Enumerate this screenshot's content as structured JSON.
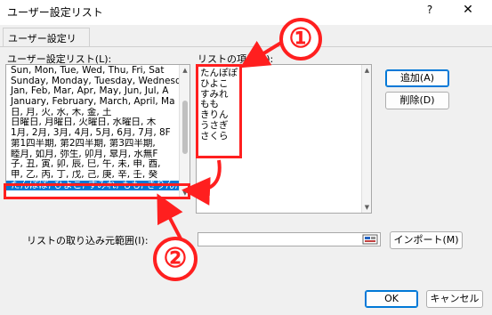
{
  "window": {
    "title": "ユーザー設定リスト",
    "help": "?",
    "close": "✕"
  },
  "tab": {
    "label": "ユーザー設定リスト"
  },
  "left": {
    "label": "ユーザー設定リスト(L):",
    "lists": [
      "Sun, Mon, Tue, Wed, Thu, Fri, Sat",
      "Sunday, Monday, Tuesday, Wednesd",
      "Jan, Feb, Mar, Apr, May, Jun, Jul, A",
      "January, February, March, April, Ma",
      "日, 月, 火, 水, 木, 金, 土",
      "日曜日, 月曜日, 火曜日, 水曜日, 木",
      "1月, 2月, 3月, 4月, 5月, 6月, 7月, 8F",
      "第1四半期, 第2四半期, 第3四半期,",
      "睦月, 如月, 弥生, 卯月, 皐月, 水無F",
      "子, 丑, 寅, 卯, 辰, 巳, 午, 未, 申, 酉,",
      "甲, 乙, 丙, 丁, 戊, 己, 庚, 辛, 壬, 癸",
      "たんぽぽ, ひよこ, すみれ, もも, きりん, う"
    ]
  },
  "right": {
    "label": "リストの項目(E):",
    "entries": [
      "たんぽぽ",
      "ひよこ",
      "すみれ",
      "もも",
      "きりん",
      "うさぎ",
      "さくら"
    ]
  },
  "buttons": {
    "add": "追加(A)",
    "delete": "削除(D)",
    "import": "インポート(M)",
    "ok": "OK",
    "cancel": "キャンセル"
  },
  "import_range": {
    "label": "リストの取り込み元範囲(I):",
    "value": ""
  },
  "annotations": {
    "one": "①",
    "two": "②",
    "color": "#ff1f1f"
  },
  "colors": {
    "selection": "#0078d7",
    "dialog_bg": "#f0f0f0"
  }
}
